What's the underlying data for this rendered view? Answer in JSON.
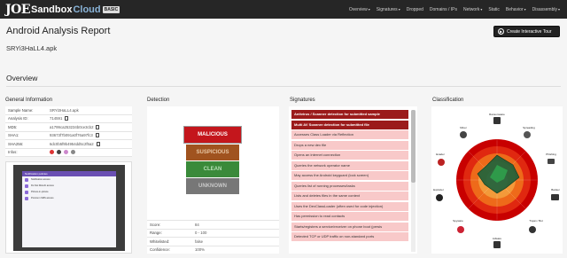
{
  "brand": {
    "joe": "JOE",
    "sandbox": "Sandbox",
    "cloud": "Cloud",
    "badge": "BASIC"
  },
  "nav": [
    {
      "label": "Overview",
      "caret": "▾"
    },
    {
      "label": "Signatures",
      "caret": "▾"
    },
    {
      "label": "Dropped",
      "caret": ""
    },
    {
      "label": "Domains / IPs",
      "caret": ""
    },
    {
      "label": "Network",
      "caret": "▾"
    },
    {
      "label": "Static",
      "caret": ""
    },
    {
      "label": "Behavior",
      "caret": "▾"
    },
    {
      "label": "Disassembly",
      "caret": "▾"
    }
  ],
  "header": {
    "title": "Android Analysis Report",
    "file_name": "SRYi3HaLL4.apk",
    "tour_button": "Create Interactive Tour"
  },
  "overview": {
    "title": "Overview"
  },
  "general_info": {
    "title": "General Information",
    "rows": [
      {
        "key": "Sample Name:",
        "value": "SRYi3HaLL4.apk"
      },
      {
        "key": "Analysis ID:",
        "value": "714591"
      },
      {
        "key": "MD5:",
        "value": "a1799ca253234b0ce3cb2"
      },
      {
        "key": "SHA1:",
        "value": "93673f7b091a0f76a97fc3"
      },
      {
        "key": "SHA256:",
        "value": "6dc0b5f9b4954dd5c2f5a2"
      },
      {
        "key": "Infos:",
        "value": ""
      }
    ]
  },
  "screenshot": {
    "app_bar": "Notification policies",
    "rows": [
      "Notification access",
      "Do Not Disturb access",
      "Picture-in-picture",
      "Premium SMS access"
    ]
  },
  "detection": {
    "title": "Detection",
    "levels": [
      "MALICIOUS",
      "SUSPICIOUS",
      "CLEAN",
      "UNKNOWN"
    ],
    "rows": [
      {
        "key": "Score:",
        "value": "84"
      },
      {
        "key": "Range:",
        "value": "0 - 100"
      },
      {
        "key": "Whitelisted:",
        "value": "false"
      },
      {
        "key": "Confidence:",
        "value": "100%"
      }
    ]
  },
  "signatures": {
    "title": "Signatures",
    "items": [
      {
        "label": "Antivirus / Scanner detection for submitted sample",
        "severity": "high"
      },
      {
        "label": "Multi AV Scanner detection for submitted file",
        "severity": "high"
      },
      {
        "label": "Accesses Class Loader via Reflection",
        "severity": "low"
      },
      {
        "label": "Drops a new dex file",
        "severity": "low"
      },
      {
        "label": "Opens an internet connection",
        "severity": "low"
      },
      {
        "label": "Queries the network operator name",
        "severity": "low"
      },
      {
        "label": "May access the Android keyguard (lock screen)",
        "severity": "low"
      },
      {
        "label": "Queries list of running processes/tasks",
        "severity": "low"
      },
      {
        "label": "Lists and deletes files in the same context",
        "severity": "low"
      },
      {
        "label": "Uses the DexClassLoader (often used for code injection)",
        "severity": "low"
      },
      {
        "label": "Has permission to read contacts",
        "severity": "low"
      },
      {
        "label": "Starts/registers a service/receiver on phone boot (persis",
        "severity": "low"
      },
      {
        "label": "Detected TCP or UDP traffic on non-standard ports",
        "severity": "low"
      }
    ]
  },
  "classification": {
    "title": "Classification",
    "labels": [
      "Ransomware",
      "Spreading",
      "Phishing",
      "Banker",
      "Trojan / Bot",
      "Adware",
      "Spyware",
      "Exploiter",
      "Evader",
      "Miner"
    ],
    "colors": {
      "outer": "#c00000",
      "mid": "#e03010",
      "inner": "#f07020",
      "core": "#f4a040",
      "area": "#1f5f3a"
    }
  },
  "colors": {
    "navbar": "#262626",
    "accent": "#8ab4d8",
    "malicious": "#c4161c",
    "sig_high": "#9b1b1b",
    "sig_low": "#f8c9c9"
  }
}
